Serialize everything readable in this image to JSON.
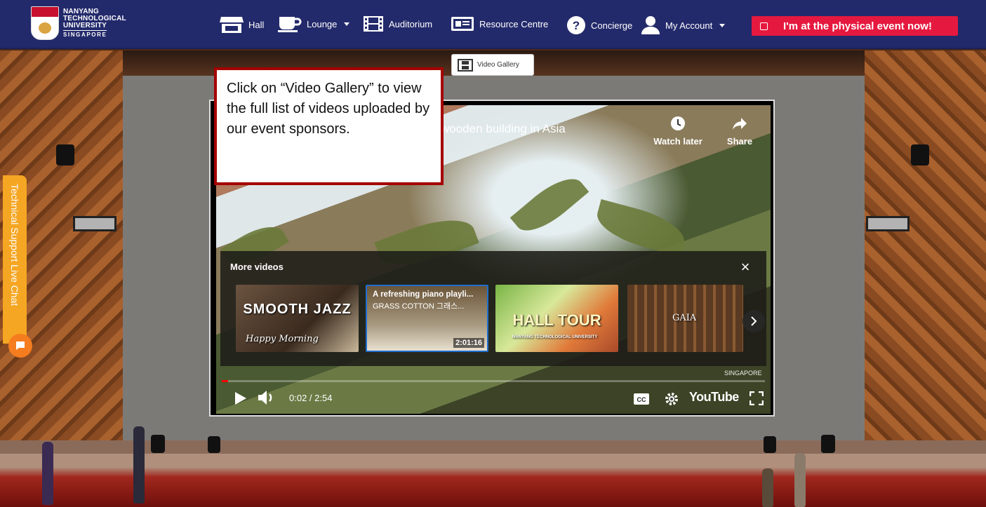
{
  "logo": {
    "line1": "NANYANG",
    "line2": "TECHNOLOGICAL",
    "line3": "UNIVERSITY",
    "line4": "SINGAPORE"
  },
  "nav": {
    "hall": "Hall",
    "lounge": "Lounge",
    "auditorium": "Auditorium",
    "resource_centre": "Resource Centre",
    "concierge": "Concierge",
    "my_account": "My Account"
  },
  "physical_event_button": "I'm at the physical event now!",
  "support_tab": "Technical Support Live Chat",
  "video_gallery_button": "Video Gallery",
  "callout": "Click on “Video Gallery” to view the full list of videos uploaded by our event sponsors.",
  "video": {
    "title_fragment": "wooden building in Asia",
    "watch_later": "Watch later",
    "share": "Share",
    "more_videos_title": "More videos",
    "thumbnails": [
      {
        "overlay": "SMOOTH JAZZ",
        "script": "Happy Morning"
      },
      {
        "title": "A refreshing piano playli...",
        "subtitle": "GRASS COTTON 그래스...",
        "duration": "2:01:16"
      },
      {
        "overlay": "HALL TOUR",
        "caption": "NANYANG TECHNOLOGICAL UNIVERSITY"
      },
      {
        "overlay": "GAIA"
      }
    ],
    "watermark": "SINGAPORE",
    "time": "0:02 / 2:54",
    "progress_fraction": 0.011,
    "youtube": "YouTube"
  },
  "colors": {
    "nav_bg": "#232a6b",
    "physical_button": "#e5193f",
    "support_tab": "#f5a623",
    "callout_border": "#a40000",
    "progress": "#ff0000"
  }
}
